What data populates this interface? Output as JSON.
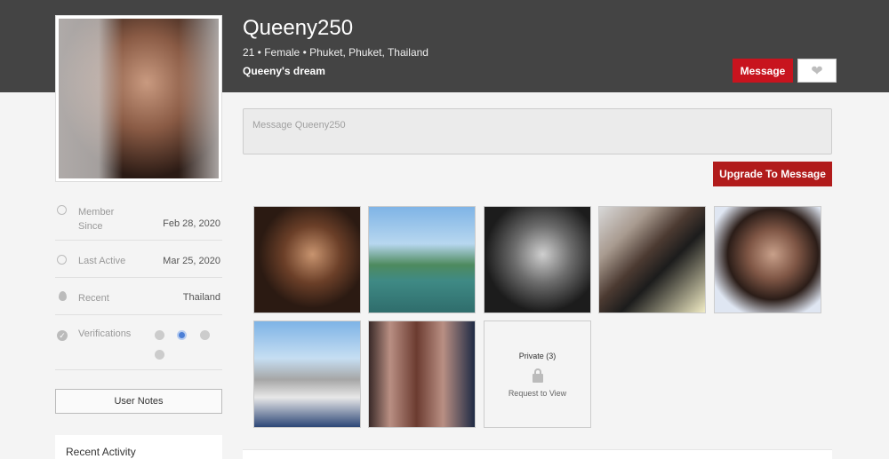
{
  "profile": {
    "username": "Queeny250",
    "meta": "21 • Female • Phuket, Phuket, Thailand",
    "tagline": "Queeny's dream"
  },
  "actions": {
    "message_label": "Message",
    "upgrade_label": "Upgrade To Message",
    "user_notes_label": "User Notes"
  },
  "message_box": {
    "placeholder": "Message Queeny250"
  },
  "sidebar": {
    "member_since_label": "Member Since",
    "member_since_value": "Feb 28, 2020",
    "last_active_label": "Last Active",
    "last_active_value": "Mar 25, 2020",
    "recent_label": "Recent",
    "recent_value": "Thailand",
    "verifications_label": "Verifications",
    "recent_activity_title": "Recent Activity"
  },
  "gallery": {
    "private_label": "Private (3)",
    "request_label": "Request to View"
  },
  "icons": {
    "like": "heart-icon",
    "clock": "clock-icon",
    "location": "map-pin-icon",
    "verified": "check-circle-icon",
    "facebook": "facebook-icon",
    "instagram": "instagram-icon",
    "profile": "user-icon",
    "linkedin": "linkedin-icon",
    "lock": "lock-icon"
  },
  "colors": {
    "header_bg": "#444444",
    "primary_red": "#c8141e",
    "upgrade_red": "#b11b1b"
  }
}
